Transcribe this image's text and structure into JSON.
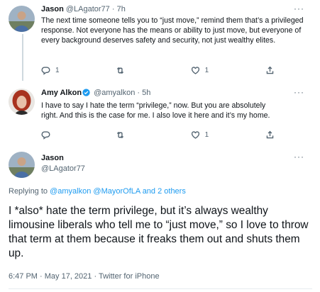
{
  "tweets": [
    {
      "name": "Jason",
      "handle": "@LAgator77",
      "separator": "·",
      "time": "7h",
      "more": "···",
      "text": "The next time someone tells you to “just move,” remind them that’s a privileged response. Not everyone has the means or ability to just move, but everyone of every background deserves safety and security, not just wealthy elites.",
      "reply_count": "1",
      "retweet_count": "",
      "like_count": "1"
    },
    {
      "name": "Amy Alkon",
      "handle": "@amyalkon",
      "separator": "·",
      "time": "5h",
      "more": "···",
      "text": "I have to say I hate the term “privilege,” now. But you are absolutely right. And this is the case for me. I also love it here and it’s my home.",
      "reply_count": "",
      "retweet_count": "",
      "like_count": "1"
    }
  ],
  "focus": {
    "name": "Jason",
    "handle": "@LAgator77",
    "more": "···",
    "replying_prefix": "Replying to",
    "mention_1": "@amyalkon",
    "mention_2": "@MayorOfLA",
    "replying_suffix": "and 2 others",
    "text": "I *also* hate the term privilege, but it’s always wealthy limousine liberals who tell me to “just move,” so I love to throw that term at them because it freaks them out and shuts them up.",
    "timestamp": "6:47 PM · May 17, 2021 · Twitter for iPhone"
  },
  "colors": {
    "link": "#1d9bf0",
    "verified": "#1d9bf0",
    "muted": "#536471"
  },
  "icons": [
    "reply-icon",
    "retweet-icon",
    "like-icon",
    "share-icon",
    "verified-badge-icon",
    "more-icon"
  ]
}
